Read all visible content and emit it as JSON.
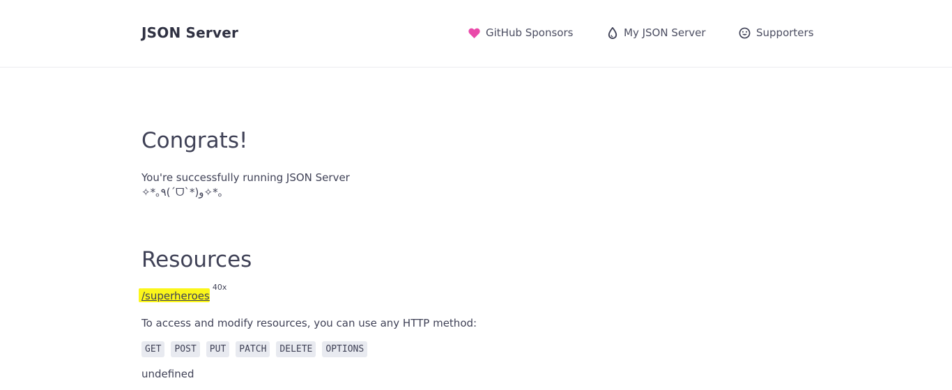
{
  "header": {
    "brand": "JSON Server",
    "nav": [
      {
        "label": "GitHub Sponsors",
        "icon": "heart-icon",
        "icon_color": "#ea4aaa"
      },
      {
        "label": "My JSON Server",
        "icon": "drop-icon"
      },
      {
        "label": "Supporters",
        "icon": "smiley-icon"
      }
    ]
  },
  "congrats": {
    "title": "Congrats!",
    "message": "You're successfully running JSON Server",
    "kaomoji": "✧*｡٩(ˊᗜˋ*)و✧*｡"
  },
  "resources": {
    "title": "Resources",
    "items": [
      {
        "path": "/superheroes",
        "count": "40x"
      }
    ],
    "access_text": "To access and modify resources, you can use any HTTP method:",
    "methods": [
      "GET",
      "POST",
      "PUT",
      "PATCH",
      "DELETE",
      "OPTIONS"
    ],
    "footer_text": "undefined"
  },
  "colors": {
    "highlight": "#fbf61a",
    "text": "#3f4156",
    "method_bg": "#e8eaf0"
  }
}
